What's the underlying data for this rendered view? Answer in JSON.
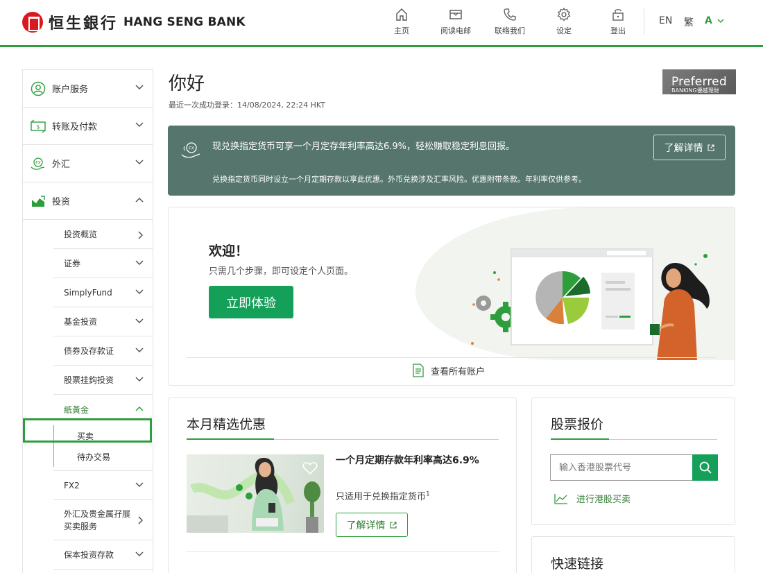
{
  "header": {
    "logo_zh": "恒生銀行",
    "logo_en": "HANG SENG BANK",
    "nav": [
      {
        "icon": "home-icon",
        "label": "主页"
      },
      {
        "icon": "mail-icon",
        "label": "阅读电邮"
      },
      {
        "icon": "phone-icon",
        "label": "联络我们"
      },
      {
        "icon": "gear-icon",
        "label": "设定"
      },
      {
        "icon": "lock-icon",
        "label": "登出"
      }
    ],
    "lang_en": "EN",
    "lang_tc": "繁",
    "font_size": "A"
  },
  "sidebar": {
    "main": [
      {
        "icon": "account-icon",
        "label": "账户服务",
        "expanded": false
      },
      {
        "icon": "transfer-icon",
        "label": "转账及付款",
        "expanded": false
      },
      {
        "icon": "fx-icon",
        "label": "外汇",
        "expanded": false
      },
      {
        "icon": "investment-icon",
        "label": "投资",
        "expanded": true
      }
    ],
    "sub": [
      {
        "label": "投资概览",
        "arrow": "right"
      },
      {
        "label": "证券",
        "arrow": "down"
      },
      {
        "label": "SimplyFund",
        "arrow": "down"
      },
      {
        "label": "基金投资",
        "arrow": "down"
      },
      {
        "label": "债券及存款证",
        "arrow": "down"
      },
      {
        "label": "股票挂鈎投资",
        "arrow": "down"
      },
      {
        "label": "紙黃金",
        "arrow": "up"
      }
    ],
    "leaves": [
      "买卖",
      "待办交易"
    ],
    "sub_after": [
      {
        "label": "FX2",
        "arrow": "down"
      },
      {
        "label": "外汇及贵金属孖展买卖服务",
        "arrow": "right"
      },
      {
        "label": "保本投资存款",
        "arrow": "down"
      }
    ]
  },
  "greeting": {
    "title": "你好",
    "last_login": "最近一次成功登录：14/08/2024, 22:24 HKT",
    "badge_line1": "Preferred",
    "badge_line2": "BANKING優越理財"
  },
  "banner": {
    "title": "现兑换指定货币可享一个月定存年利率高达6.9%，轻松赚取稳定利息回报。",
    "text": "兑换指定货币同时设立一个月定期存款以享此优惠。外币兑换涉及汇率风险。优惠附带条款。年利率仅供参考。",
    "button": "了解详情",
    "bg_color": "#55756d"
  },
  "welcome": {
    "title": "欢迎！",
    "subtitle": "只需几个步骤，即可设定个人页面。",
    "button": "立即体验",
    "link": "查看所有账户"
  },
  "offers": {
    "title": "本月精选优惠",
    "item_title": "一个月定期存款年利率高达6.9%",
    "item_sub": "只适用于兑换指定货币",
    "item_sup": "1",
    "item_button": "了解详情"
  },
  "stock": {
    "title": "股票报价",
    "placeholder": "输入香港股票代号",
    "link": "进行港股买卖"
  },
  "quick": {
    "title": "快速链接"
  },
  "colors": {
    "brand_green": "#2e9e3c",
    "button_green": "#15a05a",
    "logo_red": "#d9181f"
  }
}
